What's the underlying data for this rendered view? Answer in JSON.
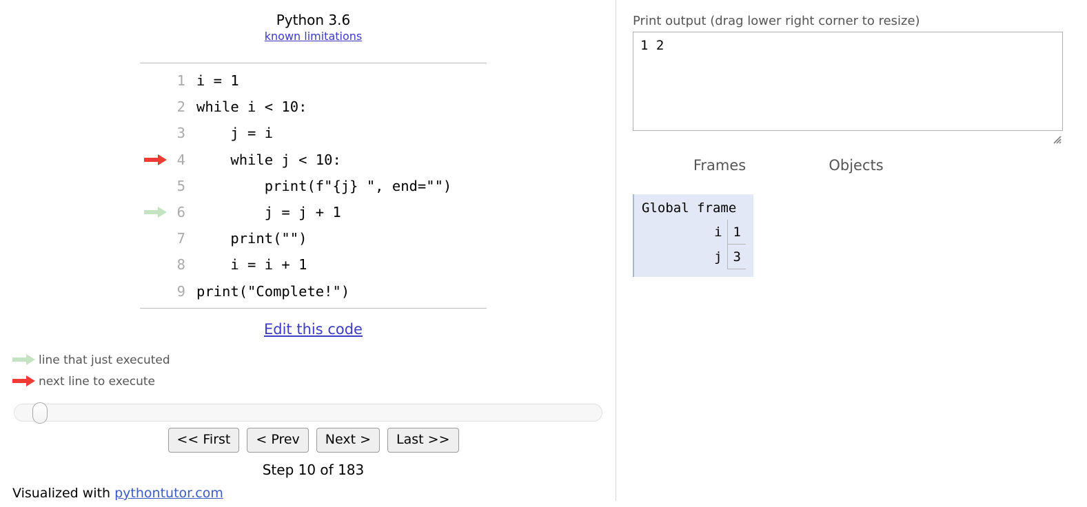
{
  "code_panel": {
    "python_version": "Python 3.6",
    "known_limitations_link": "known limitations",
    "edit_link": "Edit this code",
    "lines": [
      {
        "no": "1",
        "text": "i = 1",
        "arrow": "none"
      },
      {
        "no": "2",
        "text": "while i < 10:",
        "arrow": "none"
      },
      {
        "no": "3",
        "text": "    j = i",
        "arrow": "none"
      },
      {
        "no": "4",
        "text": "    while j < 10:",
        "arrow": "red"
      },
      {
        "no": "5",
        "text": "        print(f\"{j} \", end=\"\")",
        "arrow": "none"
      },
      {
        "no": "6",
        "text": "        j = j + 1",
        "arrow": "green"
      },
      {
        "no": "7",
        "text": "    print(\"\")",
        "arrow": "none"
      },
      {
        "no": "8",
        "text": "    i = i + 1",
        "arrow": "none"
      },
      {
        "no": "9",
        "text": "print(\"Complete!\")",
        "arrow": "none"
      }
    ]
  },
  "legend": {
    "executed_label": "line that just executed",
    "next_label": "next line to execute",
    "executed_color": "#c3e3c3",
    "next_color": "#ee3b34"
  },
  "controls": {
    "first_label": "<< First",
    "prev_label": "< Prev",
    "next_label": "Next >",
    "last_label": "Last >>",
    "step_label": "Step 10 of 183",
    "slider_position_percent": 3
  },
  "footer": {
    "prefix": "Visualized with ",
    "link": "pythontutor.com"
  },
  "output_panel": {
    "label": "Print output (drag lower right corner to resize)",
    "content": "1 2 "
  },
  "visualization": {
    "frames_header": "Frames",
    "objects_header": "Objects",
    "global_frame": {
      "title": "Global frame",
      "background": "#e2e8f5",
      "variables": [
        {
          "name": "i",
          "value": "1"
        },
        {
          "name": "j",
          "value": "3"
        }
      ]
    }
  }
}
